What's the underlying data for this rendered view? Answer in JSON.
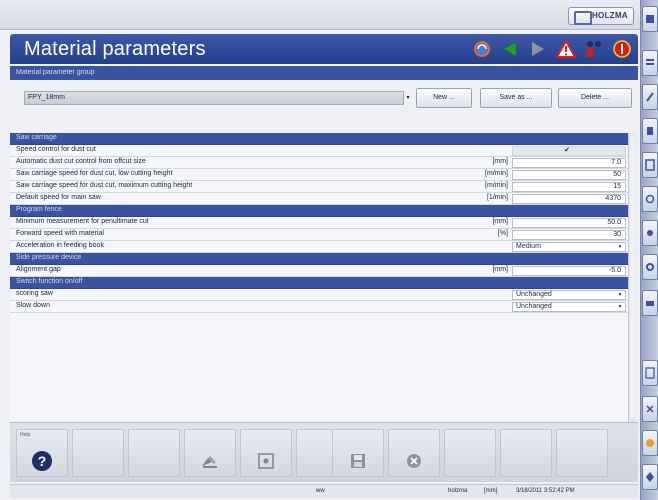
{
  "header": {
    "logo": "HOLZMA"
  },
  "window": {
    "title": "Material parameters"
  },
  "group": {
    "label": "Material parameter group",
    "selected": "FPY_18mm",
    "buttons": {
      "new": "New ...",
      "save_as": "Save as ...",
      "delete": "Delete ..."
    }
  },
  "sections": {
    "saw_carriage": "Saw carriage",
    "program_fence": "Program fence",
    "side_pressure": "Side pressure device",
    "switch_function": "Switch function on/off"
  },
  "rows": {
    "speed_control": {
      "label": "Speed control for dust cut",
      "value": "✔"
    },
    "auto_dust": {
      "label": "Automatic dust cut control from offcut size",
      "unit": "[mm]",
      "value": "7.0"
    },
    "low_height": {
      "label": "Saw carriage speed for dust cut, low cutting height",
      "unit": "[m/min]",
      "value": "50"
    },
    "max_height": {
      "label": "Saw carriage speed for dust cut, maximum cutting height",
      "unit": "[m/min]",
      "value": "15"
    },
    "main_saw": {
      "label": "Default speed for main saw",
      "unit": "[1/min]",
      "value": "4370"
    },
    "min_measure": {
      "label": "Minimum measurement for penultimate cut",
      "unit": "[mm]",
      "value": "50.0"
    },
    "forward_speed": {
      "label": "Forward speed with material",
      "unit": "[%]",
      "value": "30"
    },
    "acceleration": {
      "label": "Acceleration in feeding book",
      "value": "Medium"
    },
    "alignment_gap": {
      "label": "Alignment gap",
      "unit": "[mm]",
      "value": "-5.0"
    },
    "scoring_saw": {
      "label": "scoring saw",
      "value": "Unchanged"
    },
    "slow_down": {
      "label": "Slow down",
      "value": "Unchanged"
    }
  },
  "toolbar": {
    "help_label": "Help"
  },
  "status": {
    "center": "ww",
    "user": "holzma",
    "unit": "[mm]",
    "datetime": "3/18/2011 3:52:42 PM"
  },
  "colors": {
    "title_bar": "#2a4494",
    "section_bar": "#3a52a0",
    "warning": "#e02020",
    "go": "#2a9a2a"
  },
  "icons": [
    "refresh-icon",
    "back-arrow-icon",
    "forward-arrow-icon",
    "warning-icon",
    "operators-icon",
    "stop-icon"
  ]
}
